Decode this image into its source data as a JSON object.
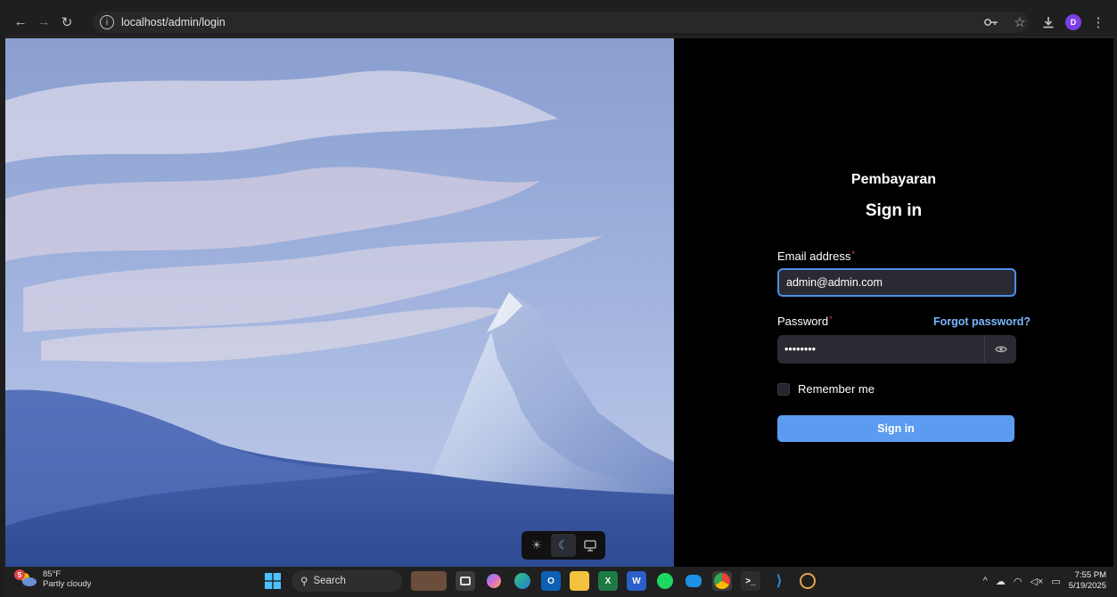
{
  "browser": {
    "url": "localhost/admin/login",
    "profile_initial": "D"
  },
  "login": {
    "brand": "Pembayaran",
    "heading": "Sign in",
    "email_label": "Email address",
    "email_value": "admin@admin.com",
    "password_label": "Password",
    "password_value": "••••••••",
    "forgot_password": "Forgot password?",
    "remember_me": "Remember me",
    "remember_checked": false,
    "submit_label": "Sign in",
    "required_mark": "*"
  },
  "theme_switcher": {
    "options": [
      "light",
      "dark",
      "system"
    ],
    "selected": "dark"
  },
  "taskbar": {
    "weather_temp": "85°F",
    "weather_desc": "Partly cloudy",
    "weather_badge": "5",
    "search_label": "Search",
    "time": "7:55 PM",
    "date": "5/19/2025"
  },
  "colors": {
    "accent": "#5b9cf0",
    "link": "#7ab7ff",
    "required": "#ef4444",
    "panel_bg": "#000000"
  }
}
